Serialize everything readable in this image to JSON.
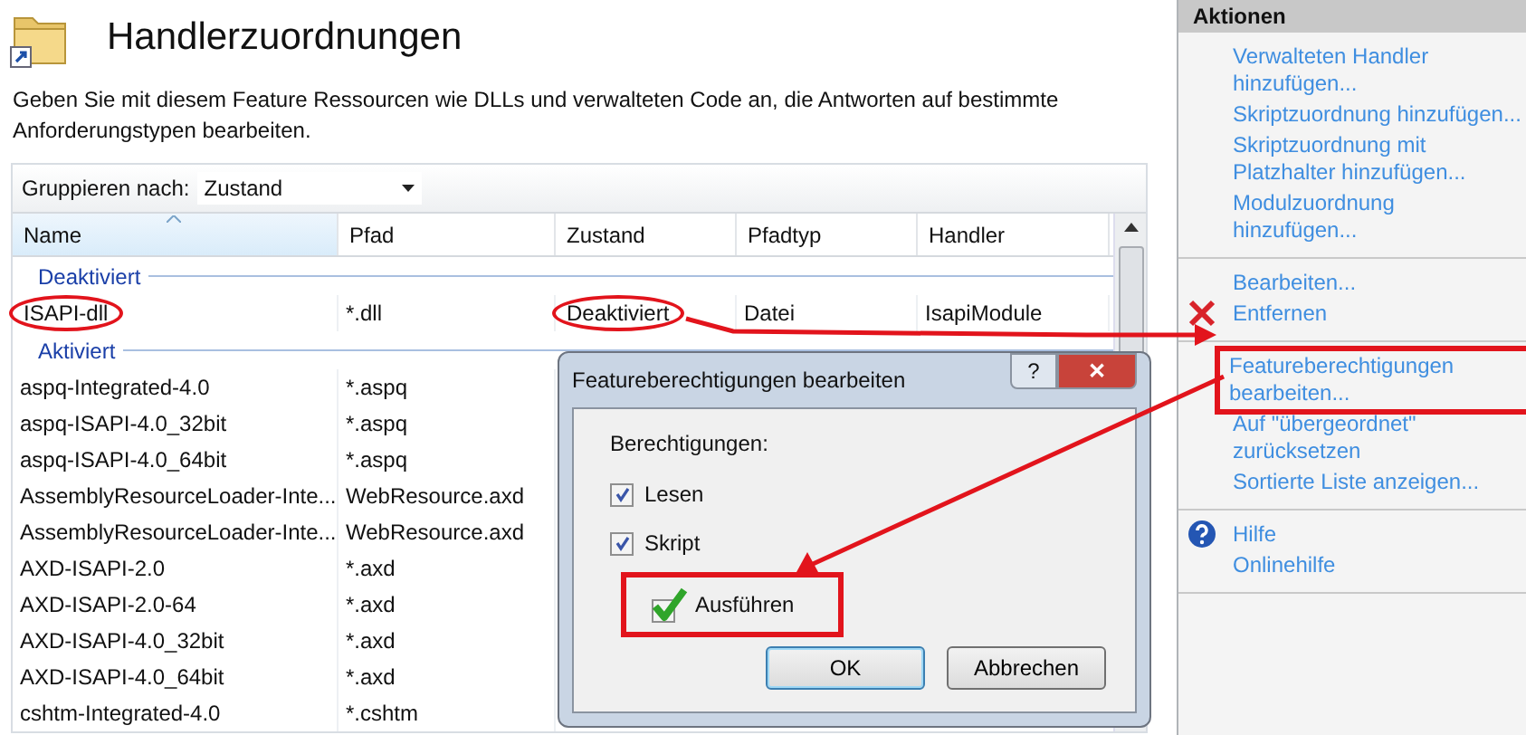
{
  "page": {
    "title": "Handlerzuordnungen",
    "description": "Geben Sie mit diesem Feature Ressourcen wie DLLs und verwalteten Code an, die Antworten auf bestimmte Anforderungstypen bearbeiten."
  },
  "group_by": {
    "label": "Gruppieren nach:",
    "value": "Zustand"
  },
  "table": {
    "columns": [
      {
        "label": "Name",
        "sorted": true
      },
      {
        "label": "Pfad",
        "sorted": false
      },
      {
        "label": "Zustand",
        "sorted": false
      },
      {
        "label": "Pfadtyp",
        "sorted": false
      },
      {
        "label": "Handler",
        "sorted": false
      }
    ],
    "groups": [
      {
        "label": "Deaktiviert",
        "rows": [
          {
            "cells": [
              "ISAPI-dll",
              "*.dll",
              "Deaktiviert",
              "Datei",
              "IsapiModule"
            ],
            "circled": [
              true,
              false,
              true,
              false,
              false
            ]
          }
        ]
      },
      {
        "label": "Aktiviert",
        "rows": [
          {
            "cells": [
              "aspq-Integrated-4.0",
              "*.aspq"
            ]
          },
          {
            "cells": [
              "aspq-ISAPI-4.0_32bit",
              "*.aspq"
            ]
          },
          {
            "cells": [
              "aspq-ISAPI-4.0_64bit",
              "*.aspq"
            ]
          },
          {
            "cells": [
              "AssemblyResourceLoader-Inte...",
              "WebResource.axd"
            ]
          },
          {
            "cells": [
              "AssemblyResourceLoader-Inte...",
              "WebResource.axd"
            ]
          },
          {
            "cells": [
              "AXD-ISAPI-2.0",
              "*.axd"
            ]
          },
          {
            "cells": [
              "AXD-ISAPI-2.0-64",
              "*.axd"
            ]
          },
          {
            "cells": [
              "AXD-ISAPI-4.0_32bit",
              "*.axd"
            ]
          },
          {
            "cells": [
              "AXD-ISAPI-4.0_64bit",
              "*.axd"
            ]
          },
          {
            "cells": [
              "cshtm-Integrated-4.0",
              "*.cshtm"
            ]
          }
        ]
      }
    ]
  },
  "actions": {
    "title": "Aktionen",
    "sections": [
      [
        {
          "label": "Verwalteten Handler hinzufügen...",
          "kind": "link",
          "highlighted": false
        },
        {
          "label": "Skriptzuordnung hinzufügen...",
          "kind": "link",
          "highlighted": false
        },
        {
          "label": "Skriptzuordnung mit Platzhalter hinzufügen...",
          "kind": "link",
          "highlighted": false
        },
        {
          "label": "Modulzuordnung hinzufügen...",
          "kind": "link",
          "highlighted": false
        }
      ],
      [
        {
          "label": "Bearbeiten...",
          "kind": "link",
          "highlighted": false
        },
        {
          "label": "Entfernen",
          "kind": "remove",
          "highlighted": false
        }
      ],
      [
        {
          "label": "Featureberechtigungen bearbeiten...",
          "kind": "link",
          "highlighted": true
        },
        {
          "label": "Auf \"übergeordnet\" zurücksetzen",
          "kind": "link",
          "highlighted": false
        },
        {
          "label": "Sortierte Liste anzeigen...",
          "kind": "link",
          "highlighted": false
        }
      ],
      [
        {
          "label": "Hilfe",
          "kind": "help",
          "highlighted": false
        },
        {
          "label": "Onlinehilfe",
          "kind": "link",
          "highlighted": false
        }
      ]
    ]
  },
  "dialog": {
    "title": "Featureberechtigungen bearbeiten",
    "help_button": "?",
    "close_button": "✕",
    "label": "Berechtigungen:",
    "checkboxes": [
      {
        "label": "Lesen",
        "checked": true,
        "highlighted": false
      },
      {
        "label": "Skript",
        "checked": true,
        "highlighted": false
      },
      {
        "label": "Ausführen",
        "checked": true,
        "highlighted": true
      }
    ],
    "buttons": [
      {
        "label": "OK",
        "default": true
      },
      {
        "label": "Abbrechen",
        "default": false
      }
    ]
  }
}
